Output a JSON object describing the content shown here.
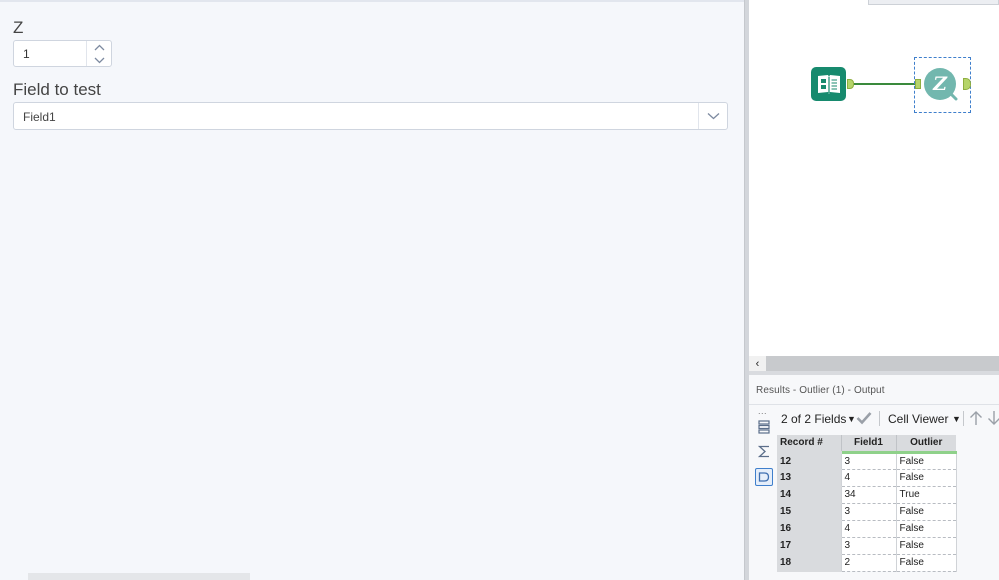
{
  "config": {
    "z_label": "Z",
    "z_value": "1",
    "field_label": "Field to test",
    "field_value": "Field1"
  },
  "results": {
    "title": "Results - Outlier (1) - Output",
    "dots": "...",
    "toolbar": {
      "fields_label": "2 of 2 Fields",
      "viewer_label": "Cell Viewer"
    },
    "columns": [
      "Record #",
      "Field1",
      "Outlier"
    ],
    "rows": [
      [
        "12",
        "3",
        "False"
      ],
      [
        "13",
        "4",
        "False"
      ],
      [
        "14",
        "34",
        "True"
      ],
      [
        "15",
        "3",
        "False"
      ],
      [
        "16",
        "4",
        "False"
      ],
      [
        "17",
        "3",
        "False"
      ],
      [
        "18",
        "2",
        "False"
      ]
    ]
  },
  "canvas": {
    "outlier_glyph": "Z",
    "tools": [
      {
        "name": "input-data-tool",
        "icon": "book-icon",
        "color": "#178a6e"
      },
      {
        "name": "outlier-tool",
        "icon": "z-magnifier-icon",
        "color": "#72b7ae"
      }
    ],
    "connector_color": "#3a8a3c",
    "anchor_color": "#b5d46a",
    "selection_color": "#3f7fcc"
  },
  "icons": {
    "check": "check-icon",
    "up": "arrow-up-icon",
    "down": "arrow-down-icon",
    "metadata": "metadata-icon",
    "summary": "sigma-icon",
    "data": "data-icon"
  }
}
